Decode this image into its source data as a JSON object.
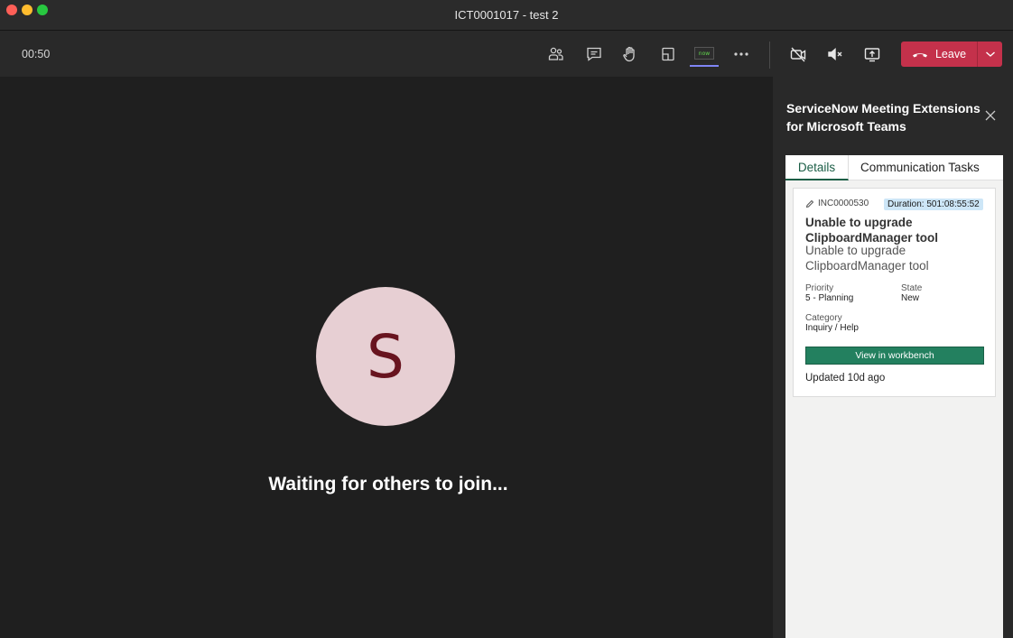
{
  "window": {
    "title": "ICT0001017 - test 2"
  },
  "toolbar": {
    "timer": "00:50",
    "buttons": [
      {
        "name": "people-icon"
      },
      {
        "name": "chat-icon"
      },
      {
        "name": "raise-hand-icon"
      },
      {
        "name": "rooms-icon"
      },
      {
        "name": "servicenow-app-icon",
        "label": "now"
      },
      {
        "name": "more-icon"
      },
      {
        "name": "camera-off-icon"
      },
      {
        "name": "mic-muted-icon"
      },
      {
        "name": "share-icon"
      }
    ],
    "leave_label": "Leave",
    "leave_color": "#c4314b"
  },
  "stage": {
    "avatar_initial": "S",
    "avatar_bg": "#e7cfd3",
    "avatar_fg": "#68141f",
    "waiting_text": "Waiting for others to join..."
  },
  "panel": {
    "title": "ServiceNow Meeting Extensions for Microsoft Teams",
    "tabs": [
      {
        "label": "Details",
        "active": true
      },
      {
        "label": "Communication Tasks",
        "active": false
      }
    ],
    "card": {
      "number": "INC0000530",
      "duration": "Duration: 501:08:55:52",
      "title": "Unable to upgrade ClipboardManager tool",
      "description": "Unable to upgrade ClipboardManager tool",
      "fields": {
        "priority_label": "Priority",
        "priority_value": "5 - Planning",
        "state_label": "State",
        "state_value": "New",
        "category_label": "Category",
        "category_value": "Inquiry / Help"
      },
      "button_label": "View in workbench",
      "button_color": "#23805f",
      "updated": "Updated 10d ago"
    }
  }
}
